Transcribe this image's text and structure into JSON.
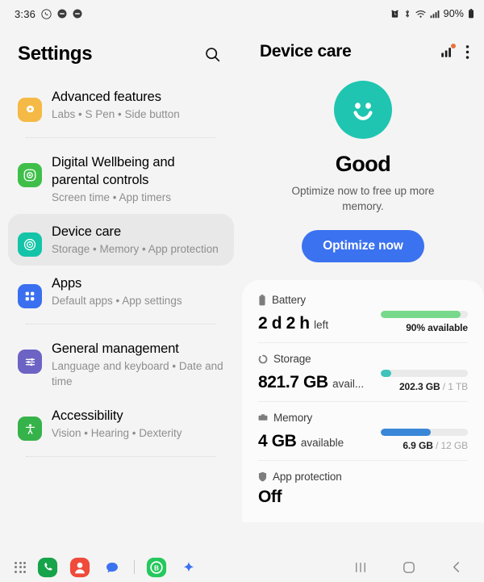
{
  "statusbar": {
    "time": "3:36",
    "left_icons": [
      "whatsapp-icon",
      "notification-dot-icon",
      "notification-dot-icon"
    ],
    "right_icons": [
      "alarm-icon",
      "bluetooth-icon",
      "wifi-icon",
      "signal-icon"
    ],
    "battery_percent": "90%",
    "battery_icon": "battery-icon"
  },
  "settings": {
    "title": "Settings",
    "search_icon": "search-icon",
    "items": [
      {
        "id": "advanced-features",
        "label": "Advanced features",
        "summary": "Labs  •  S Pen  •  Side button",
        "icon": "gear-icon",
        "color": "#f5b945",
        "selected": false
      },
      {
        "id": "digital-wellbeing",
        "label": "Digital Wellbeing and parental controls",
        "summary": "Screen time  •  App timers",
        "icon": "wellbeing-icon",
        "color": "#3fbf4a",
        "selected": false
      },
      {
        "id": "device-care",
        "label": "Device care",
        "summary": "Storage  •  Memory  •  App protection",
        "icon": "device-care-icon",
        "color": "#14c4a8",
        "selected": true
      },
      {
        "id": "apps",
        "label": "Apps",
        "summary": "Default apps  •  App settings",
        "icon": "apps-grid-icon",
        "color": "#3a6ff0",
        "selected": false
      },
      {
        "id": "general-management",
        "label": "General management",
        "summary": "Language and keyboard  •  Date and time",
        "icon": "sliders-icon",
        "color": "#6d63c4",
        "selected": false
      },
      {
        "id": "accessibility",
        "label": "Accessibility",
        "summary": "Vision  •  Hearing  •  Dexterity",
        "icon": "accessibility-icon",
        "color": "#36b24a",
        "selected": false
      }
    ]
  },
  "device_care": {
    "title": "Device care",
    "chart_icon": "bar-chart-icon",
    "menu_icon": "more-options-icon",
    "status_face": "smiley-face-icon",
    "status_color": "#1fc5b0",
    "status_title": "Good",
    "status_subtitle": "Optimize now to free up more memory.",
    "optimize_label": "Optimize now",
    "optimize_color": "#3b72f0",
    "cards": [
      {
        "id": "battery",
        "icon": "battery-icon",
        "label": "Battery",
        "value": "2 d 2 h",
        "unit": "left",
        "meter_text": "90% available",
        "meter_muted": "",
        "meter_percent": 92,
        "meter_color": "#78d88b"
      },
      {
        "id": "storage",
        "icon": "storage-icon",
        "label": "Storage",
        "value": "821.7 GB",
        "unit": "avail...",
        "meter_text": "202.3 GB",
        "meter_muted": " / 1 TB",
        "meter_percent": 12,
        "meter_color": "#3ec4bb"
      },
      {
        "id": "memory",
        "icon": "memory-icon",
        "label": "Memory",
        "value": "4 GB",
        "unit": "available",
        "meter_text": "6.9 GB",
        "meter_muted": " / 12 GB",
        "meter_percent": 57,
        "meter_color": "#3a87d8"
      },
      {
        "id": "app-protection",
        "icon": "shield-icon",
        "label": "App protection",
        "value": "Off",
        "unit": "",
        "meter_text": "",
        "meter_muted": "",
        "meter_percent": 0,
        "meter_color": "#cccccc"
      }
    ]
  },
  "taskbar": {
    "apps": [
      {
        "id": "app-drawer",
        "icon": "app-drawer-dots-icon"
      },
      {
        "id": "phone",
        "icon": "phone-icon",
        "color": "#16a34a"
      },
      {
        "id": "contacts",
        "icon": "contacts-icon",
        "color": "#ef4a3a"
      },
      {
        "id": "messages",
        "icon": "messages-icon",
        "color": "#3b72f0"
      },
      {
        "id": "whatsapp-business",
        "icon": "whatsapp-business-icon",
        "color": "#25c85c"
      },
      {
        "id": "ai-assistant",
        "icon": "sparkle-icon",
        "color": "#3b72f0"
      }
    ],
    "nav": [
      {
        "id": "recents",
        "icon": "recents-icon"
      },
      {
        "id": "home",
        "icon": "home-icon"
      },
      {
        "id": "back",
        "icon": "back-icon"
      }
    ]
  }
}
